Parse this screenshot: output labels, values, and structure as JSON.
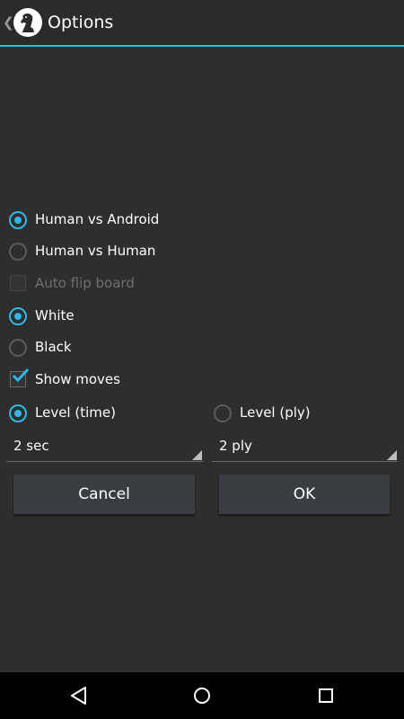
{
  "app": {
    "title": "Options",
    "up_icon": "chevron-left-icon",
    "logo_icon": "chess-knight-icon"
  },
  "game_mode": {
    "options": [
      {
        "label": "Human vs Android",
        "selected": true
      },
      {
        "label": "Human vs Human",
        "selected": false
      }
    ]
  },
  "auto_flip": {
    "label": "Auto flip board",
    "checked": false,
    "enabled": false
  },
  "color": {
    "options": [
      {
        "label": "White",
        "selected": true
      },
      {
        "label": "Black",
        "selected": false
      }
    ]
  },
  "show_moves": {
    "label": "Show moves",
    "checked": true
  },
  "level": {
    "time": {
      "label": "Level (time)",
      "selected": true,
      "value": "2 sec"
    },
    "ply": {
      "label": "Level (ply)",
      "selected": false,
      "value": "2 ply"
    }
  },
  "buttons": {
    "cancel": "Cancel",
    "ok": "OK"
  },
  "navigation": {
    "back_icon": "back-triangle-icon",
    "home_icon": "home-circle-icon",
    "recents_icon": "recents-square-icon"
  },
  "colors": {
    "accent": "#33b5e5",
    "background": "#2e2e2e",
    "button": "#3a3e42",
    "navbar": "#000000"
  }
}
